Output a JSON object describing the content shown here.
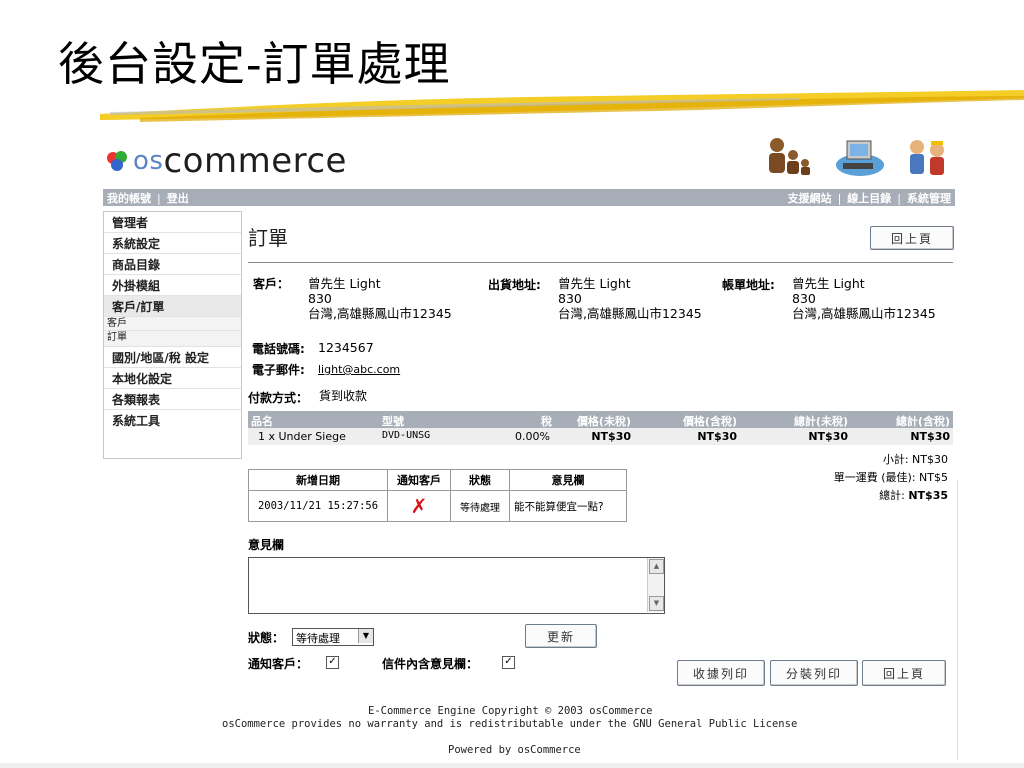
{
  "slide_title": "後台設定-訂單處理",
  "logo": {
    "os": "os",
    "commerce": "commerce"
  },
  "navbar": {
    "account": "我的帳號",
    "logout": "登出",
    "support": "支援網站",
    "catalog": "線上目錄",
    "admin": "系統管理"
  },
  "sidebar": {
    "items": [
      "管理者",
      "系統設定",
      "商品目錄",
      "外掛模組",
      "客戶/訂單"
    ],
    "sub_customers": "客戶",
    "sub_orders": "訂單",
    "items2": [
      "國別/地區/稅 設定",
      "本地化設定",
      "各類報表",
      "系統工具"
    ]
  },
  "page_heading": "訂單",
  "back_label": "回上頁",
  "customer": {
    "label": "客戶：",
    "name": "曾先生 Light",
    "line2": "830",
    "line3": "台灣,高雄縣鳳山市12345"
  },
  "shipping": {
    "label": "出貨地址:",
    "name": "曾先生 Light",
    "line2": "830",
    "line3": "台灣,高雄縣鳳山市12345"
  },
  "billing": {
    "label": "帳單地址:",
    "name": "曾先生 Light",
    "line2": "830",
    "line3": "台灣,高雄縣鳳山市12345"
  },
  "phone": {
    "label": "電話號碼:",
    "value": "1234567"
  },
  "email": {
    "label": "電子郵件:",
    "value": "light@abc.com"
  },
  "payment": {
    "label": "付款方式：",
    "value": "貨到收款"
  },
  "products": {
    "headers": [
      "品名",
      "型號",
      "稅",
      "價格(未稅)",
      "價格(含稅)",
      "總計(未稅)",
      "總計(含稅)"
    ],
    "row": [
      "1 x Under Siege",
      "DVD-UNSG",
      "0.00%",
      "NT$30",
      "NT$30",
      "NT$30",
      "NT$30"
    ]
  },
  "totals": {
    "subtotal_label": "小計:",
    "subtotal_value": "NT$30",
    "shipping_label": "單一運費 (最佳):",
    "shipping_value": "NT$5",
    "total_label": "總計:",
    "total_value": "NT$35"
  },
  "history": {
    "headers": [
      "新增日期",
      "通知客戶",
      "狀態",
      "意見欄"
    ],
    "row": {
      "date": "2003/11/21 15:27:56",
      "notified": "✗",
      "status": "等待處理",
      "comment": "能不能算便宜一點?"
    }
  },
  "comments_label": "意見欄",
  "comments_value": "",
  "status": {
    "label": "狀態：",
    "selected": "等待處理"
  },
  "update_label": "更新",
  "notify": {
    "label": "通知客戶：",
    "checked": "✓"
  },
  "append": {
    "label": "信件內含意見欄：",
    "checked": "✓"
  },
  "buttons": {
    "invoice": "收據列印",
    "packing": "分裝列印",
    "back": "回上頁"
  },
  "footer": {
    "line1": "E-Commerce Engine Copyright © 2003 osCommerce",
    "line2": "osCommerce provides no warranty and is redistributable under the GNU General Public License",
    "line3": "Powered by osCommerce"
  },
  "colors": {
    "bar": "#a8aeb8",
    "logo_blue": "#5b86c4",
    "cross_red": "#dd1111",
    "brush_yellow": "#f2c400"
  }
}
